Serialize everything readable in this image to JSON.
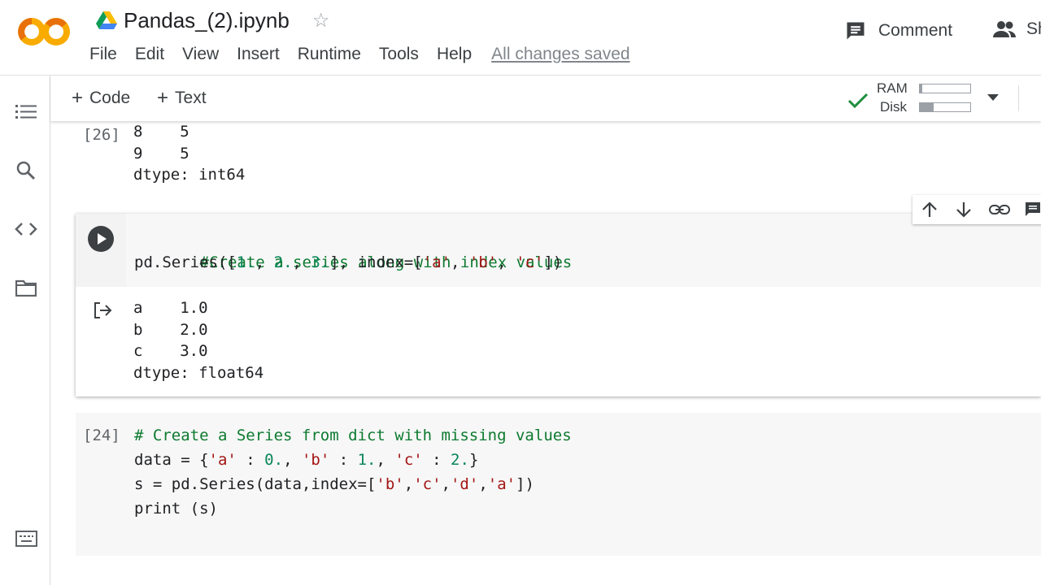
{
  "app": {
    "notebook_title": "Pandas_(2).ipynb",
    "menu": [
      "File",
      "Edit",
      "View",
      "Insert",
      "Runtime",
      "Tools",
      "Help"
    ],
    "save_status": "All changes saved",
    "comment_label": "Comment",
    "share_label": "Sh"
  },
  "toolbar": {
    "add_code_label": "Code",
    "add_text_label": "Text",
    "ram_label": "RAM",
    "disk_label": "Disk",
    "ram_usage": 0.05,
    "disk_usage": 0.28,
    "connected_color": "#1e8e3e"
  },
  "cells": {
    "previous": {
      "exec_count": "[26]",
      "output": [
        "8    5",
        "9    5",
        "dtype: int64"
      ]
    },
    "active": {
      "comment": "#Create a series along with index values",
      "code_line2": {
        "p1": "pd.Series([",
        "n1": "1.",
        "s1": ", ",
        "n2": "2.",
        "s2": ", ",
        "n3": "3.",
        "p2": "], index=[",
        "a": "'a'",
        "sep1": ", ",
        "b": "'b'",
        "sep2": ", ",
        "c": "'c'",
        "p3": "])"
      },
      "output": [
        "a    1.0",
        "b    2.0",
        "c    3.0",
        "dtype: float64"
      ]
    },
    "next": {
      "exec_count": "[24]",
      "comment": "# Create a Series from dict with missing values",
      "line2": {
        "p1": "data = {",
        "a": "'a'",
        "p2": " : ",
        "v0": "0.",
        "p3": ", ",
        "b": "'b'",
        "p4": " : ",
        "v1": "1.",
        "p5": ", ",
        "c": "'c'",
        "p6": " : ",
        "v2": "2.",
        "p7": "}"
      },
      "line3": {
        "p1": "s = pd.Series(data,index=[",
        "b": "'b'",
        "s1": ",",
        "c": "'c'",
        "s2": ",",
        "d": "'d'",
        "s3": ",",
        "a": "'a'",
        "p2": "])"
      },
      "line4": "print (s)"
    }
  },
  "icons": [
    "colab-logo",
    "drive-icon",
    "star-icon",
    "comment-icon",
    "people-icon",
    "toc-icon",
    "search-icon",
    "code-snippets-icon",
    "folder-icon",
    "terminal-icon",
    "run-icon",
    "output-icon",
    "check-icon",
    "arrow-up-icon",
    "arrow-down-icon",
    "link-icon",
    "comment-cell-icon"
  ]
}
